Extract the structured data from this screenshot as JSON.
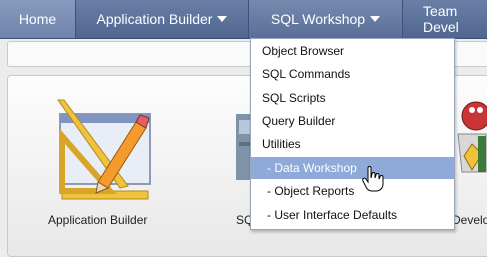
{
  "nav": {
    "home": "Home",
    "app_builder": "Application Builder",
    "sql_workshop": "SQL Workshop",
    "team_dev": "Team Devel"
  },
  "menu": {
    "items": [
      "Object Browser",
      "SQL Commands",
      "SQL Scripts",
      "Query Builder",
      "Utilities"
    ],
    "sub_items": [
      "- Data Workshop",
      "- Object Reports",
      "- User Interface Defaults"
    ],
    "active": "- Data Workshop"
  },
  "tiles": {
    "app_builder": "Application Builder",
    "sql_partial": "SQ",
    "team_partial": "Develop"
  },
  "colors": {
    "nav": "#506690",
    "active_item": "#8fa9d8"
  }
}
